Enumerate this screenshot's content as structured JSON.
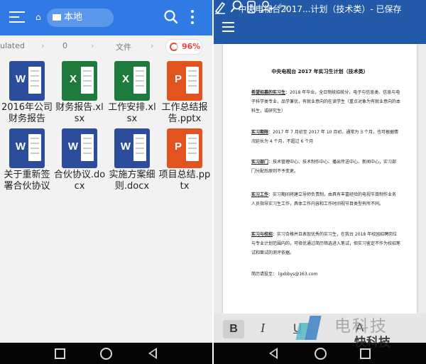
{
  "left": {
    "home_glyph": "⌂",
    "location_label": "本地",
    "breadcrumb": [
      "ulated",
      "0",
      "文件"
    ],
    "storage_percent": "96%",
    "files": [
      {
        "name": "2016年公司财务报告",
        "type": "word"
      },
      {
        "name": "财务报告.xlsx",
        "type": "excel"
      },
      {
        "name": "工作安排.xlsx",
        "type": "excel"
      },
      {
        "name": "工作总结报告.pptx",
        "type": "ppt"
      },
      {
        "name": "关于重新签署合伙协议",
        "type": "word"
      },
      {
        "name": "合伙协议.docx",
        "type": "word"
      },
      {
        "name": "实施方案细则.docx",
        "type": "word"
      },
      {
        "name": "项目总结.pptx",
        "type": "ppt"
      }
    ],
    "badges": {
      "word": "W",
      "excel": "X",
      "ppt": "P"
    }
  },
  "right": {
    "title": "中央电视台2017...计划（技术类）- 已保存",
    "doc_title": "中央电视台 2017 年实习生计划（技术类）",
    "paragraphs": [
      {
        "key": "希望招募的实习生",
        "text": "：2018 年毕业，全日制统招统分，电子与信息类、信息与电子科学类专业，品学兼优，有就业意向的在读学生（重点对象为有就业意向的本科生，或研究生）"
      },
      {
        "key": "实习期限",
        "text": "：2017 年 7 月初至 2017 年 10 月初，通常为 3 个月，也可根据情况延长为 4 个月，不超过 6 个月"
      },
      {
        "key": "实习部门",
        "text": "：技术管理中心、技术制作中心、播出传送中心、新闻中心，实习部门分配后原则不予变更。"
      },
      {
        "key": "实习工作",
        "text": "：实习期间将建立导师负责制，由具有丰富经验的电视节目制作业务人员指导实习生工作，具体工作内容和工作时间视节目类型有所不同。"
      },
      {
        "key": "实习与校招",
        "text": "：实习合格并且表现优秀的实习生，在我台 2018 年校园招聘岗位与专业计划范围内的，可择优通过简历筛选进入笔试，但实习鉴定不作为校招笔试和面试的测评依据。"
      },
      {
        "key": "",
        "text": "简历请投至：  lgxbbys@163.com"
      }
    ],
    "format_bar": {
      "bold": "B",
      "italic": "I",
      "underline": "U",
      "font_color": "A"
    }
  },
  "watermark": {
    "line1": "电科技",
    "line2": "快科技"
  },
  "colors": {
    "left_bar": "#2f7be3",
    "right_bar": "#2359a9",
    "word": "#2b4d9c",
    "excel": "#1f7a3e",
    "ppt": "#e2541f",
    "storage": "#e6463f"
  }
}
